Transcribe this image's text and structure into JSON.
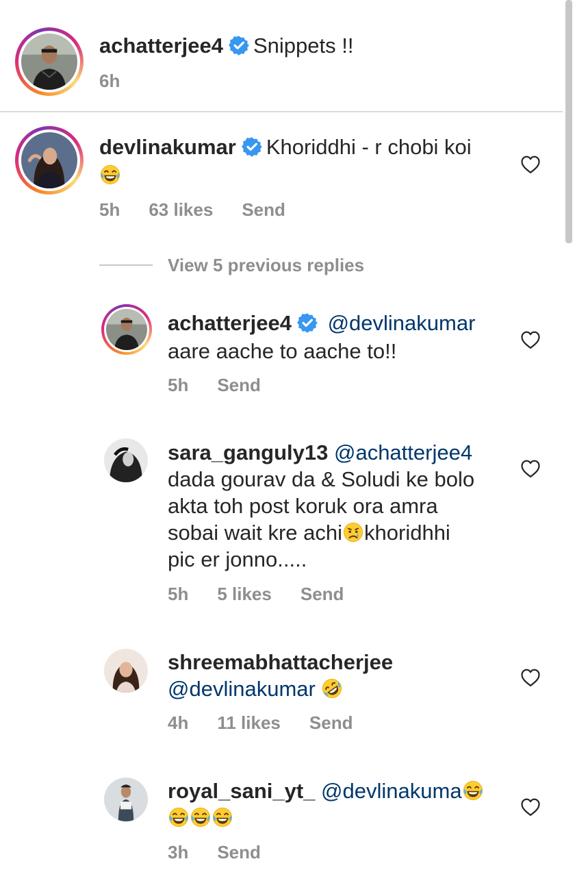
{
  "caption": {
    "username": "achatterjee4",
    "text": "Snippets !!",
    "time": "6h"
  },
  "comments": [
    {
      "username": "devlinakumar",
      "text": "Khoriddhi - r chobi koi",
      "time": "5h",
      "likes": "63 likes",
      "send": "Send"
    }
  ],
  "view_replies": "View 5 previous replies",
  "replies": [
    {
      "username": "achatterjee4",
      "mention": "@devlinakumar",
      "text": "aare aache to aache to!!",
      "time": "5h",
      "send": "Send"
    },
    {
      "username": "sara_ganguly13",
      "mention": "@achatterjee4",
      "lines": [
        "dada gourav da & Soludi ke bolo",
        "akta toh post koruk ora amra",
        "sobai wait kre achi",
        "khoridhhi",
        "pic er jonno....."
      ],
      "time": "5h",
      "likes": "5 likes",
      "send": "Send"
    },
    {
      "username": "shreemabhattacherjee",
      "mention": "@devlinakumar",
      "time": "4h",
      "likes": "11 likes",
      "send": "Send"
    },
    {
      "username": "royal_sani_yt_",
      "mention": "@devlinakuma",
      "time": "3h",
      "send": "Send"
    }
  ],
  "icons": {
    "verified": "verified-badge-icon",
    "heart": "heart-outline-icon",
    "laugh": "face-with-tears-of-joy-emoji",
    "rofl": "rolling-on-floor-laughing-emoji",
    "sad": "sad-tear-emoji"
  },
  "colors": {
    "verified": "#3897f0",
    "mention": "#00376b",
    "meta": "#8e8e8e"
  }
}
